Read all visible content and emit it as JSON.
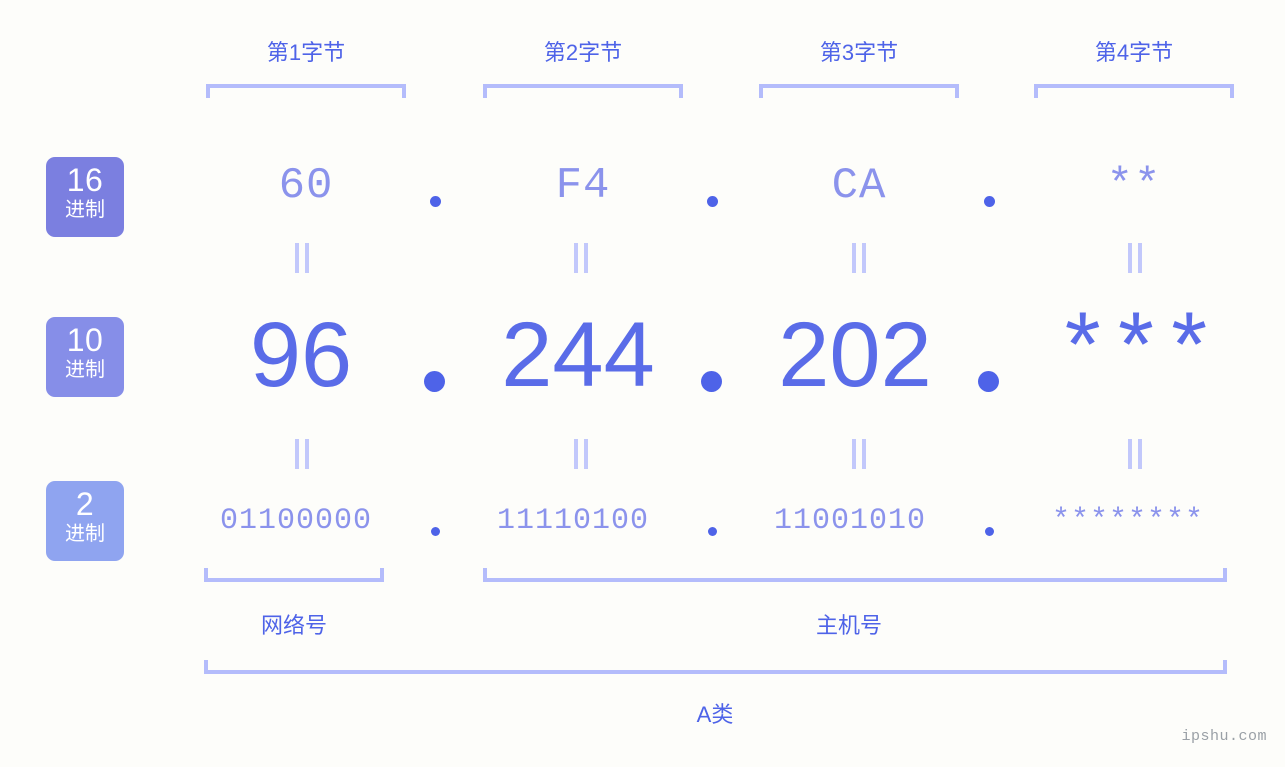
{
  "watermark": "ipshu.com",
  "byte_headers": [
    {
      "label": "第1字节"
    },
    {
      "label": "第2字节"
    },
    {
      "label": "第3字节"
    },
    {
      "label": "第4字节"
    }
  ],
  "bases": [
    {
      "number": "16",
      "suffix": "进制",
      "color": "#7b7fe0"
    },
    {
      "number": "10",
      "suffix": "进制",
      "color": "#868ee8"
    },
    {
      "number": "2",
      "suffix": "进制",
      "color": "#8fa4f0"
    }
  ],
  "rows": {
    "hex": {
      "values": [
        "60",
        "F4",
        "CA",
        "**"
      ]
    },
    "dec": {
      "values": [
        "96",
        "244",
        "202",
        "***"
      ]
    },
    "bin": {
      "values": [
        "01100000",
        "11110100",
        "11001010",
        "********"
      ]
    }
  },
  "separator": ".",
  "equals": "=",
  "sections": [
    {
      "label": "网络号"
    },
    {
      "label": "主机号"
    }
  ],
  "class_label": "A类",
  "colors": {
    "background": "#fdfdfa",
    "accent": "#4e63e8",
    "value_light": "#8b93ec",
    "value_strong": "#5a6ce8",
    "bracket": "#b4bcfb",
    "equals": "#c2c8fb",
    "watermark": "#9aa0a6"
  }
}
